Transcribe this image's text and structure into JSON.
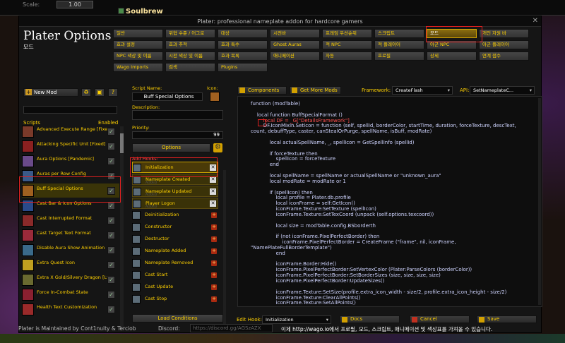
{
  "game": {
    "scale_label": "Scale:",
    "scale_value": "1.00",
    "title": "Soulbrew"
  },
  "window": {
    "title": "Plater: professional nameplate addon for hardcore gamers",
    "heading": "Plater Options",
    "subheading": "모드",
    "close": "✕"
  },
  "tabs": [
    {
      "label": "일반"
    },
    {
      "label": "위협 수준 / 어그로"
    },
    {
      "label": "대상"
    },
    {
      "label": "시전바"
    },
    {
      "label": "프레임 우선순위"
    },
    {
      "label": "스크립트"
    },
    {
      "label": "모드"
    },
    {
      "label": "개인 자원 바"
    },
    {
      "label": "효과 설정"
    },
    {
      "label": "효과 추적"
    },
    {
      "label": "효과 특수"
    },
    {
      "label": "Ghost Auras"
    },
    {
      "label": "적 NPC"
    },
    {
      "label": "적 플레이어"
    },
    {
      "label": "아군 NPC"
    },
    {
      "label": "아군 플레이어"
    },
    {
      "label": "NPC 색상 및 이름"
    },
    {
      "label": "시전 색상 및 이름"
    },
    {
      "label": "효과 목록"
    },
    {
      "label": "애니메이션"
    },
    {
      "label": "자동"
    },
    {
      "label": "프로필"
    },
    {
      "label": "상세"
    },
    {
      "label": "연계 점수"
    },
    {
      "label": "Wago Imports"
    },
    {
      "label": "검색"
    },
    {
      "label": "Plugins"
    }
  ],
  "sidebar": {
    "new_mod_label": "New Mod",
    "icons": [
      "recycle-icon",
      "lock-icon",
      "help-icon"
    ],
    "scripts_header": "Scripts",
    "enabled_header": "Enabled",
    "mods": [
      {
        "label": "Advanced Execute Range [Fixed]",
        "color": "#7a3a2a"
      },
      {
        "label": "Attacking Specific Unit [Fixed]",
        "color": "#8a2020"
      },
      {
        "label": "Aura Options [Pandemic]",
        "color": "#6a4a8a"
      },
      {
        "label": "Auras per Row Config",
        "color": "#3a5a8a"
      },
      {
        "label": "Buff Special Options",
        "color": "#a06020"
      },
      {
        "label": "Cast Bar & Icon Options",
        "color": "#2a4a8a"
      },
      {
        "label": "Cast Interrupted Format",
        "color": "#8a2a2a"
      },
      {
        "label": "Cast Target Text Format",
        "color": "#9a2a3a"
      },
      {
        "label": "Disable Aura Show Animation",
        "color": "#3a6a8a"
      },
      {
        "label": "Extra Quest Icon",
        "color": "#c0a020"
      },
      {
        "label": "Extra X Gold/Silvery Dragon [Lvl]",
        "color": "#6a6a30"
      },
      {
        "label": "Force In-Combat State",
        "color": "#8a2030"
      },
      {
        "label": "Health Text Customization",
        "color": "#9a2a2a"
      }
    ]
  },
  "editor": {
    "script_name_label": "Script Name:",
    "icon_label": "Icon:",
    "script_name": "Buff Special Options",
    "description_label": "Description:",
    "priority_label": "Priority:",
    "priority_value": "99",
    "options_button": "Options",
    "add_hooks_label": "Add Hooks:",
    "hooks": [
      {
        "label": "Initialization",
        "sub": "",
        "state": "selected"
      },
      {
        "label": "Nameplate Created",
        "sub": "ADDED",
        "state": "added"
      },
      {
        "label": "Nameplate Updated",
        "sub": "ADDED",
        "state": "added"
      },
      {
        "label": "Player Logon",
        "sub": "ADDED",
        "state": "added"
      },
      {
        "label": "Deinitialization",
        "sub": "",
        "state": "none"
      },
      {
        "label": "Constructor",
        "sub": "",
        "state": "none"
      },
      {
        "label": "Destructor",
        "sub": "",
        "state": "none"
      },
      {
        "label": "Nameplate Added",
        "sub": "",
        "state": "none"
      },
      {
        "label": "Nameplate Removed",
        "sub": "",
        "state": "none"
      },
      {
        "label": "Cast Start",
        "sub": "",
        "state": "none"
      },
      {
        "label": "Cast Update",
        "sub": "",
        "state": "none"
      },
      {
        "label": "Cast Stop",
        "sub": "",
        "state": "none"
      }
    ],
    "load_conditions": "Load Conditions"
  },
  "code_toolbar": {
    "components": "Components",
    "get_more_mods": "Get More Mods",
    "framework_label": "Framework:",
    "framework_value": "CreateFlash",
    "api_label": "API:",
    "api_value": "SetNameplateC..."
  },
  "code_lines": [
    "function (modTable)",
    "",
    "    local function BuffSpecialFormat ()",
    "        local DF = _G[\"DetailsFramework\"]",
    "        DF.IconMixin.SetIcon = function (self, spellId, borderColor, startTime, duration, forceTexture, descText,",
    "count, debuffType, caster, canStealOrPurge, spellName, isBuff, modRate)",
    "",
    "            local actualSpellName, _, spellIcon = GetSpellInfo (spellId)",
    "",
    "            if forceTexture then",
    "                spellIcon = forceTexture",
    "            end",
    "",
    "            local spellName = spellName or actualSpellName or \"unknown_aura\"",
    "            local modRate = modRate or 1",
    "",
    "            if (spellIcon) then",
    "                local profile = Plater.db.profile",
    "                local iconFrame = self:GetIcon()",
    "                iconFrame.Texture:SetTexture (spellIcon)",
    "                iconFrame.Texture:SetTexCoord (unpack (self.options.texcoord))",
    "",
    "                local size = modTable.config.BSborderth",
    "",
    "                if (not iconFrame.PixelPerfectBorder) then",
    "                    iconFrame.PixelPerfectBorder = CreateFrame (\"frame\", nil, iconFrame,",
    "\"NamePlateFullBorderTemplate\")",
    "                end",
    "",
    "                iconFrame.Border:Hide()",
    "                iconFrame.PixelPerfectBorder:SetVertexColor (Plater:ParseColors (borderColor))",
    "                iconFrame.PixelPerfectBorder:SetBorderSizes (size, size, size, size)",
    "                iconFrame.PixelPerfectBorder:UpdateSizes()",
    "",
    "                iconFrame.Texture:SetSize(profile.extra_icon_width - size/2, profile.extra_icon_height - size/2)",
    "                iconFrame.Texture:ClearAllPoints()",
    "                iconFrame.Texture:SetAllPoints()"
  ],
  "bottom_bar": {
    "edit_hook_label": "Edit Hook:",
    "edit_hook_value": "Initialization",
    "docs": "Docs",
    "cancel": "Cancel",
    "save": "Save"
  },
  "footer": {
    "maintained": "Plater is Maintained by Cont1nuity & Terciob",
    "discord_label": "Discord:",
    "discord_link": "https://discord.gg/AGSzAZX",
    "right_text": "이제 http://wago.io에서 프로필, 모드, 스크립트, 애니메이션 및 색상표를 가져올 수 있습니다."
  },
  "colors": {
    "accent": "#ffd100",
    "highlight_box": "#e02020"
  }
}
